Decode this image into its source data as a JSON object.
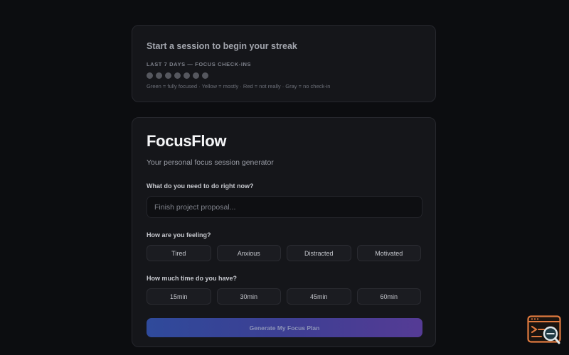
{
  "streak": {
    "title": "Start a session to begin your streak",
    "label": "LAST 7 DAYS — FOCUS CHECK-INS",
    "days": [
      "no-check-in",
      "no-check-in",
      "no-check-in",
      "no-check-in",
      "no-check-in",
      "no-check-in",
      "no-check-in"
    ],
    "legend": "Green = fully focused · Yellow = mostly · Red = not really · Gray = no check-in",
    "colors": {
      "no_check_in": "#55575e"
    }
  },
  "app": {
    "title": "FocusFlow",
    "subtitle": "Your personal focus session generator"
  },
  "task": {
    "label": "What do you need to do right now?",
    "placeholder": "Finish project proposal...",
    "value": ""
  },
  "mood": {
    "label": "How are you feeling?",
    "options": [
      "Tired",
      "Anxious",
      "Distracted",
      "Motivated"
    ],
    "selected": null
  },
  "time": {
    "label": "How much time do you have?",
    "options": [
      "15min",
      "30min",
      "45min",
      "60min"
    ],
    "selected": null
  },
  "cta": {
    "label": "Generate My Focus Plan",
    "gradient": [
      "#2f4a9b",
      "#553b95"
    ]
  },
  "widget": {
    "icon": "code-search-icon",
    "accent": "#e07a3f"
  }
}
